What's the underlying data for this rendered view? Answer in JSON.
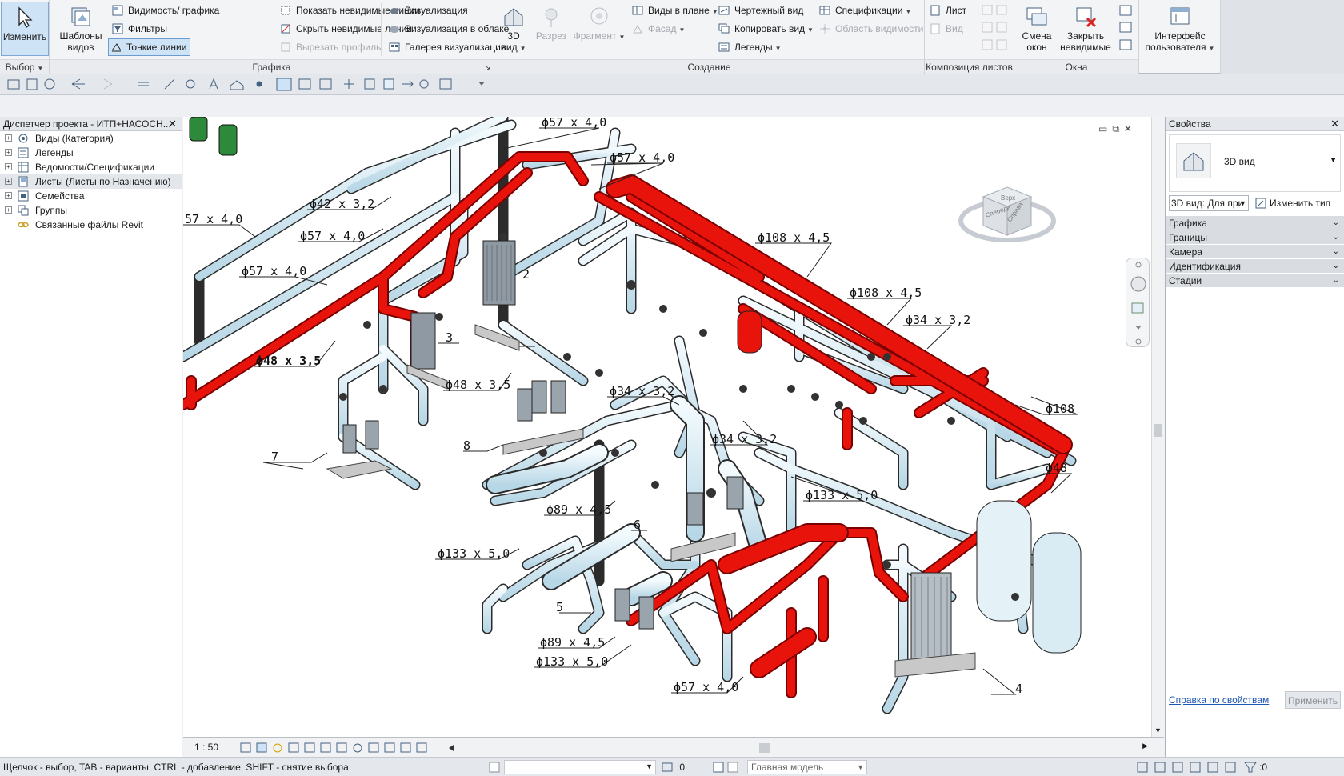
{
  "ribbon": {
    "select_panel": {
      "modify_label": "Изменить",
      "panel_label": "Выбор"
    },
    "graphics_panel": {
      "view_templates_label": "Шаблоны видов",
      "visibility_graphics": "Видимость/ графика",
      "filters": "Фильтры",
      "thin_lines": "Тонкие линии",
      "show_hidden_lines": "Показать невидимые линии",
      "hide_hidden_lines": "Скрыть невидимые линии",
      "cut_profile": "Вырезать профиль",
      "render": "Визуализация",
      "render_cloud": "Визуализация  в облаке",
      "render_gallery": "Галерея  визуализации",
      "panel_label": "Графика"
    },
    "create_panel": {
      "view3d_label": "3D вид",
      "section_label": "Разрез",
      "callout_label": "Фрагмент",
      "plan_views": "Виды в плане",
      "elevation": "Фасад",
      "drafting_view": "Чертежный вид",
      "duplicate_view": "Копировать вид",
      "legends": "Легенды",
      "schedules": "Спецификации",
      "scope_box": "Область видимости",
      "panel_label": "Создание"
    },
    "sheet_panel": {
      "sheet": "Лист",
      "view": "Вид",
      "panel_label": "Композиция листов"
    },
    "windows_panel": {
      "switch_windows": "Смена окон",
      "close_hidden": "Закрыть невидимые",
      "user_interface": "Интерфейс пользователя",
      "panel_label": "Окна"
    }
  },
  "browser": {
    "title": "Диспетчер проекта - ИТП+НАСОСН...",
    "items": [
      {
        "label": "Виды (Категория)"
      },
      {
        "label": "Легенды"
      },
      {
        "label": "Ведомости/Спецификации"
      },
      {
        "label": "Листы (Листы по Назначению)"
      },
      {
        "label": "Семейства"
      },
      {
        "label": "Группы"
      },
      {
        "label": "Связанные файлы Revit"
      }
    ]
  },
  "view": {
    "scale": "1 : 50",
    "viewcube": {
      "top": "Верх",
      "front": "Спереди",
      "right": "Справа"
    },
    "labels": {
      "l1": "ϕ57 x 4,0",
      "l2": "ϕ57 x 4,0",
      "l3": "ϕ42 x 3,2",
      "l4": "57 x 4,0",
      "l5": "ϕ57 x 4,0",
      "l6": "ϕ57 x 4,0",
      "l7": "ϕ108 x 4,5",
      "l8": "ϕ108 x 4,5",
      "l9": "ϕ34 x 3,2",
      "l10": "ϕ48 x 3,5",
      "l11": "ϕ48 x 3,5",
      "l12": "ϕ34 x 3,2",
      "l13": "ϕ108",
      "l14": "ϕ34 x 3,2",
      "l15": "ϕ48",
      "l16": "ϕ133 x 5,0",
      "l17": "ϕ89 x 4,5",
      "l18": "ϕ133 x 5,0",
      "l19": "ϕ89 x 4,5",
      "l20": "ϕ133 x 5,0",
      "l21": "ϕ57 x 4,0",
      "n2": "2",
      "n3": "3",
      "n4": "4",
      "n5": "5",
      "n6": "6",
      "n7": "7",
      "n8": "8"
    }
  },
  "properties": {
    "title": "Свойства",
    "type_name": "3D вид",
    "selector_value": "3D вид: Для при",
    "edit_type": "Изменить тип",
    "groups": [
      {
        "label": "Графика"
      },
      {
        "label": "Границы"
      },
      {
        "label": "Камера"
      },
      {
        "label": "Идентификация"
      },
      {
        "label": "Стадии"
      }
    ],
    "help_link": "Справка по свойствам",
    "apply": "Применить"
  },
  "status": {
    "hint": "Щелчок - выбор, TAB - варианты, CTRL - добавление, SHIFT - снятие выбора.",
    "coord": ":0",
    "model": "Главная модель",
    "filter_count": ":0"
  },
  "colors": {
    "hot_pipe": "#e8140c",
    "cold_pipe": "#cfe6f0",
    "selection": "#cfe3f7"
  }
}
